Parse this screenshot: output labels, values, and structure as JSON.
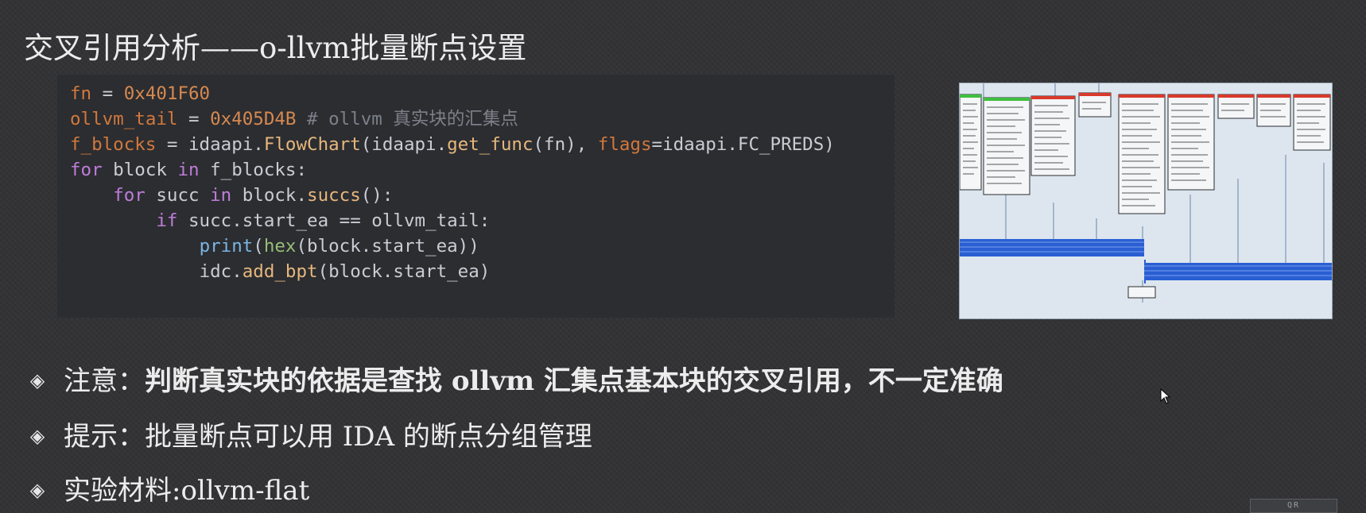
{
  "slide": {
    "title": "交叉引用分析——o-llvm批量断点设置"
  },
  "code": {
    "line1": {
      "var": "fn",
      "op": " = ",
      "value": "0x401F60"
    },
    "line2": {
      "var": "ollvm_tail",
      "op": " = ",
      "value": "0x405D4B",
      "comment": " # ollvm 真实块的汇集点"
    },
    "line3": {
      "var": "f_blocks",
      "op": " = ",
      "call": "idaapi.",
      "fn": "FlowChart",
      "args_a": "(idaapi.",
      "fn2": "get_func",
      "args_b": "(fn), ",
      "kwarg": "flags",
      "args_c": "=idaapi.FC_PREDS)"
    },
    "line4": {
      "kw1": "for",
      "mid": " block ",
      "kw2": "in",
      "rest": " f_blocks:"
    },
    "line5": {
      "indent": "    ",
      "kw1": "for",
      "mid": " succ ",
      "kw2": "in",
      "rest": " block.",
      "fn": "succs",
      "end": "():"
    },
    "line6": {
      "indent": "        ",
      "kw": "if",
      "rest": " succ.start_ea ",
      "op": "==",
      "end": " ollvm_tail:"
    },
    "line7": {
      "indent": "            ",
      "fn": "print",
      "p1": "(",
      "fn2": "hex",
      "rest": "(block.start_ea))"
    },
    "line8": {
      "indent": "            ",
      "obj": "idc.",
      "fn": "add_bpt",
      "rest": "(block.start_ea)"
    }
  },
  "bullets": [
    {
      "symbol": "◈",
      "label": "注意：",
      "text": "判断真实块的依据是查找 ollvm 汇集点基本块的交叉引用，不一定准确"
    },
    {
      "symbol": "◈",
      "label": "提示：",
      "text": "批量断点可以用 IDA 的断点分组管理"
    },
    {
      "symbol": "◈",
      "label": "实验材料:",
      "text": "ollvm-flat"
    }
  ],
  "watermark": {
    "text": "QR"
  },
  "colors": {
    "background": "#333336",
    "code_bg": "#2b2d31",
    "keyword": "#c07cd9",
    "variable": "#d2783c",
    "number": "#d7894f",
    "comment": "#7c8088",
    "graph_bg": "#dde6ef",
    "graph_bar": "#2a5fd3",
    "graph_header_red": "#d93a2b",
    "graph_header_green": "#3fbf3f"
  }
}
